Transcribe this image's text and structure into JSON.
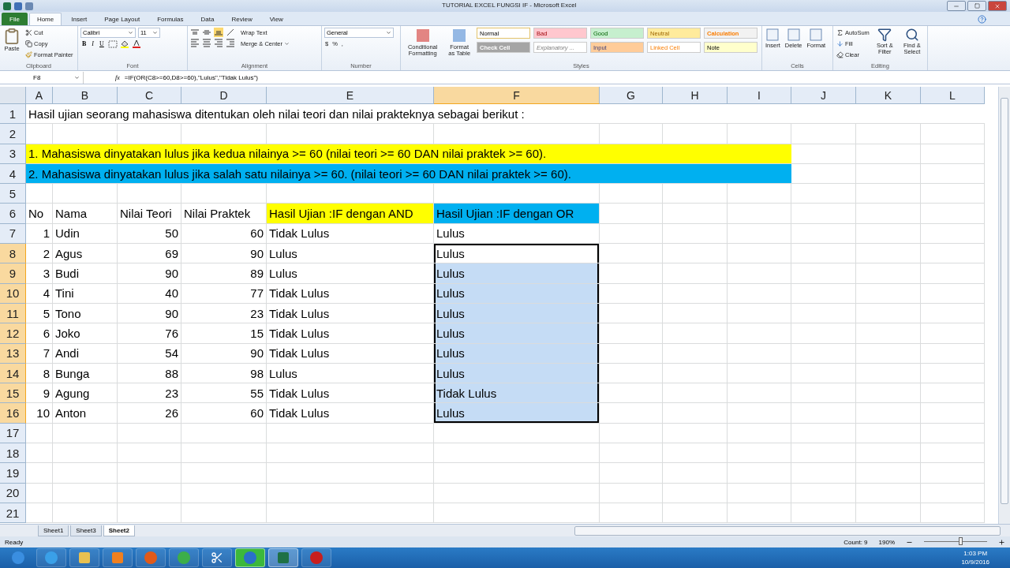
{
  "window": {
    "title": "TUTORIAL EXCEL FUNGSI IF - Microsoft Excel"
  },
  "ribbon": {
    "tabs": [
      {
        "label": "File",
        "selected": false,
        "kind": "file"
      },
      {
        "label": "Home",
        "selected": true,
        "kind": "tab"
      },
      {
        "label": "Insert",
        "selected": false,
        "kind": "tab"
      },
      {
        "label": "Page Layout",
        "selected": false,
        "kind": "tab"
      },
      {
        "label": "Formulas",
        "selected": false,
        "kind": "tab"
      },
      {
        "label": "Data",
        "selected": false,
        "kind": "tab"
      },
      {
        "label": "Review",
        "selected": false,
        "kind": "tab"
      },
      {
        "label": "View",
        "selected": false,
        "kind": "tab"
      }
    ],
    "clipboard": {
      "label": "Clipboard",
      "paste": "Paste",
      "items": [
        "Cut",
        "Copy",
        "Format Painter"
      ]
    },
    "font": {
      "label": "Font",
      "name": "Calibri",
      "size": "11",
      "styles": [
        "B",
        "I",
        "U"
      ]
    },
    "alignment": {
      "label": "Alignment",
      "wrap": "Wrap Text",
      "merge": "Merge & Center"
    },
    "number": {
      "label": "Number",
      "format": "General",
      "symbols": [
        "$",
        "%",
        ","
      ]
    },
    "styles": {
      "label": "Styles",
      "buttons": [
        "Conditional Formatting",
        "Format as Table"
      ],
      "cells": [
        {
          "label": "Normal",
          "color": "#ffffff"
        },
        {
          "label": "Bad",
          "color": "#ffc7ce"
        },
        {
          "label": "Good",
          "color": "#c6efce"
        },
        {
          "label": "Neutral",
          "color": "#ffeb9c"
        },
        {
          "label": "Calculation",
          "color": "#f2f2f2"
        },
        {
          "label": "Check Cell",
          "color": "#a5a5a5"
        },
        {
          "label": "Explanatory ...",
          "color": "#ffffff"
        },
        {
          "label": "Input",
          "color": "#ffcc99"
        },
        {
          "label": "Linked Cell",
          "color": "#ffffff"
        },
        {
          "label": "Note",
          "color": "#ffffcc"
        }
      ]
    },
    "cells_group": {
      "label": "Cells",
      "buttons": [
        "Insert",
        "Delete",
        "Format"
      ]
    },
    "editing": {
      "label": "Editing",
      "items": [
        "AutoSum",
        "Fill",
        "Clear"
      ],
      "buttons": [
        "Sort & Filter",
        "Find & Select"
      ]
    }
  },
  "formula_bar": {
    "name_box": "F8",
    "fx": "fx",
    "formula": "=IF(OR(C8>=60,D8>=60),\"Lulus\",\"Tidak Lulus\")"
  },
  "sheet": {
    "columns": [
      {
        "label": "A",
        "selected": false
      },
      {
        "label": "B",
        "selected": false
      },
      {
        "label": "C",
        "selected": false
      },
      {
        "label": "D",
        "selected": false
      },
      {
        "label": "E",
        "selected": false
      },
      {
        "label": "F",
        "selected": true
      },
      {
        "label": "G",
        "selected": false
      },
      {
        "label": "H",
        "selected": false
      },
      {
        "label": "I",
        "selected": false
      },
      {
        "label": "J",
        "selected": false
      },
      {
        "label": "K",
        "selected": false
      },
      {
        "label": "L",
        "selected": false
      }
    ],
    "rows": [
      {
        "number": "1",
        "selected": false,
        "kind": "note",
        "text": "Hasil ujian seorang mahasiswa ditentukan oleh nilai teori dan nilai prakteknya sebagai berikut :"
      },
      {
        "number": "2",
        "selected": false,
        "kind": "empty"
      },
      {
        "number": "3",
        "selected": false,
        "kind": "note",
        "text": "1. Mahasiswa dinyatakan lulus jika kedua nilainya >= 60 (nilai teori >= 60 DAN nilai praktek >= 60).",
        "color": "#ffff00"
      },
      {
        "number": "4",
        "selected": false,
        "kind": "note",
        "text": "2. Mahasiswa dinyatakan lulus jika salah satu nilainya >= 60. (nilai teori >= 60 DAN nilai praktek >= 60).",
        "color": "#00b0f0"
      },
      {
        "number": "5",
        "selected": false,
        "kind": "empty"
      },
      {
        "number": "6",
        "selected": false,
        "kind": "header",
        "cells": [
          {
            "text": "No"
          },
          {
            "text": "Nama"
          },
          {
            "text": "Nilai Teori"
          },
          {
            "text": "Nilai Praktek"
          },
          {
            "text": "Hasil Ujian :IF dengan AND",
            "color": "#ffff00"
          },
          {
            "text": "Hasil Ujian :IF dengan OR",
            "color": "#00b0f0"
          }
        ]
      },
      {
        "number": "7",
        "selected": false,
        "kind": "data",
        "cells": [
          "1",
          "Udin",
          "50",
          "60",
          "Tidak Lulus",
          "Lulus"
        ]
      },
      {
        "number": "8",
        "selected": true,
        "active": true,
        "kind": "data",
        "cells": [
          "2",
          "Agus",
          "69",
          "90",
          "Lulus",
          "Lulus"
        ]
      },
      {
        "number": "9",
        "selected": true,
        "kind": "data",
        "cells": [
          "3",
          "Budi",
          "90",
          "89",
          "Lulus",
          "Lulus"
        ]
      },
      {
        "number": "10",
        "selected": true,
        "kind": "data",
        "cells": [
          "4",
          "Tini",
          "40",
          "77",
          "Tidak Lulus",
          "Lulus"
        ]
      },
      {
        "number": "11",
        "selected": true,
        "kind": "data",
        "cells": [
          "5",
          "Tono",
          "90",
          "23",
          "Tidak Lulus",
          "Lulus"
        ]
      },
      {
        "number": "12",
        "selected": true,
        "kind": "data",
        "cells": [
          "6",
          "Joko",
          "76",
          "15",
          "Tidak Lulus",
          "Lulus"
        ]
      },
      {
        "number": "13",
        "selected": true,
        "kind": "data",
        "cells": [
          "7",
          "Andi",
          "54",
          "90",
          "Tidak Lulus",
          "Lulus"
        ]
      },
      {
        "number": "14",
        "selected": true,
        "kind": "data",
        "cells": [
          "8",
          "Bunga",
          "88",
          "98",
          "Lulus",
          "Lulus"
        ]
      },
      {
        "number": "15",
        "selected": true,
        "kind": "data",
        "cells": [
          "9",
          "Agung",
          "23",
          "55",
          "Tidak Lulus",
          "Tidak Lulus"
        ]
      },
      {
        "number": "16",
        "selected": true,
        "kind": "data",
        "cells": [
          "10",
          "Anton",
          "26",
          "60",
          "Tidak Lulus",
          "Lulus"
        ]
      },
      {
        "number": "17",
        "selected": false,
        "kind": "empty"
      },
      {
        "number": "18",
        "selected": false,
        "kind": "empty"
      },
      {
        "number": "19",
        "selected": false,
        "kind": "empty"
      },
      {
        "number": "20",
        "selected": false,
        "kind": "empty"
      },
      {
        "number": "21",
        "selected": false,
        "kind": "empty"
      }
    ]
  },
  "sheet_tabs": [
    {
      "label": "Sheet1",
      "selected": false
    },
    {
      "label": "Sheet3",
      "selected": false
    },
    {
      "label": "Sheet2",
      "selected": true
    }
  ],
  "status_bar": {
    "mode": "Ready",
    "count": "Count: 9",
    "zoom": "190%",
    "zoom_slider": {
      "level": 0.58
    }
  },
  "taskbar": {
    "time": "1:03 PM",
    "date": "10/9/2016"
  }
}
